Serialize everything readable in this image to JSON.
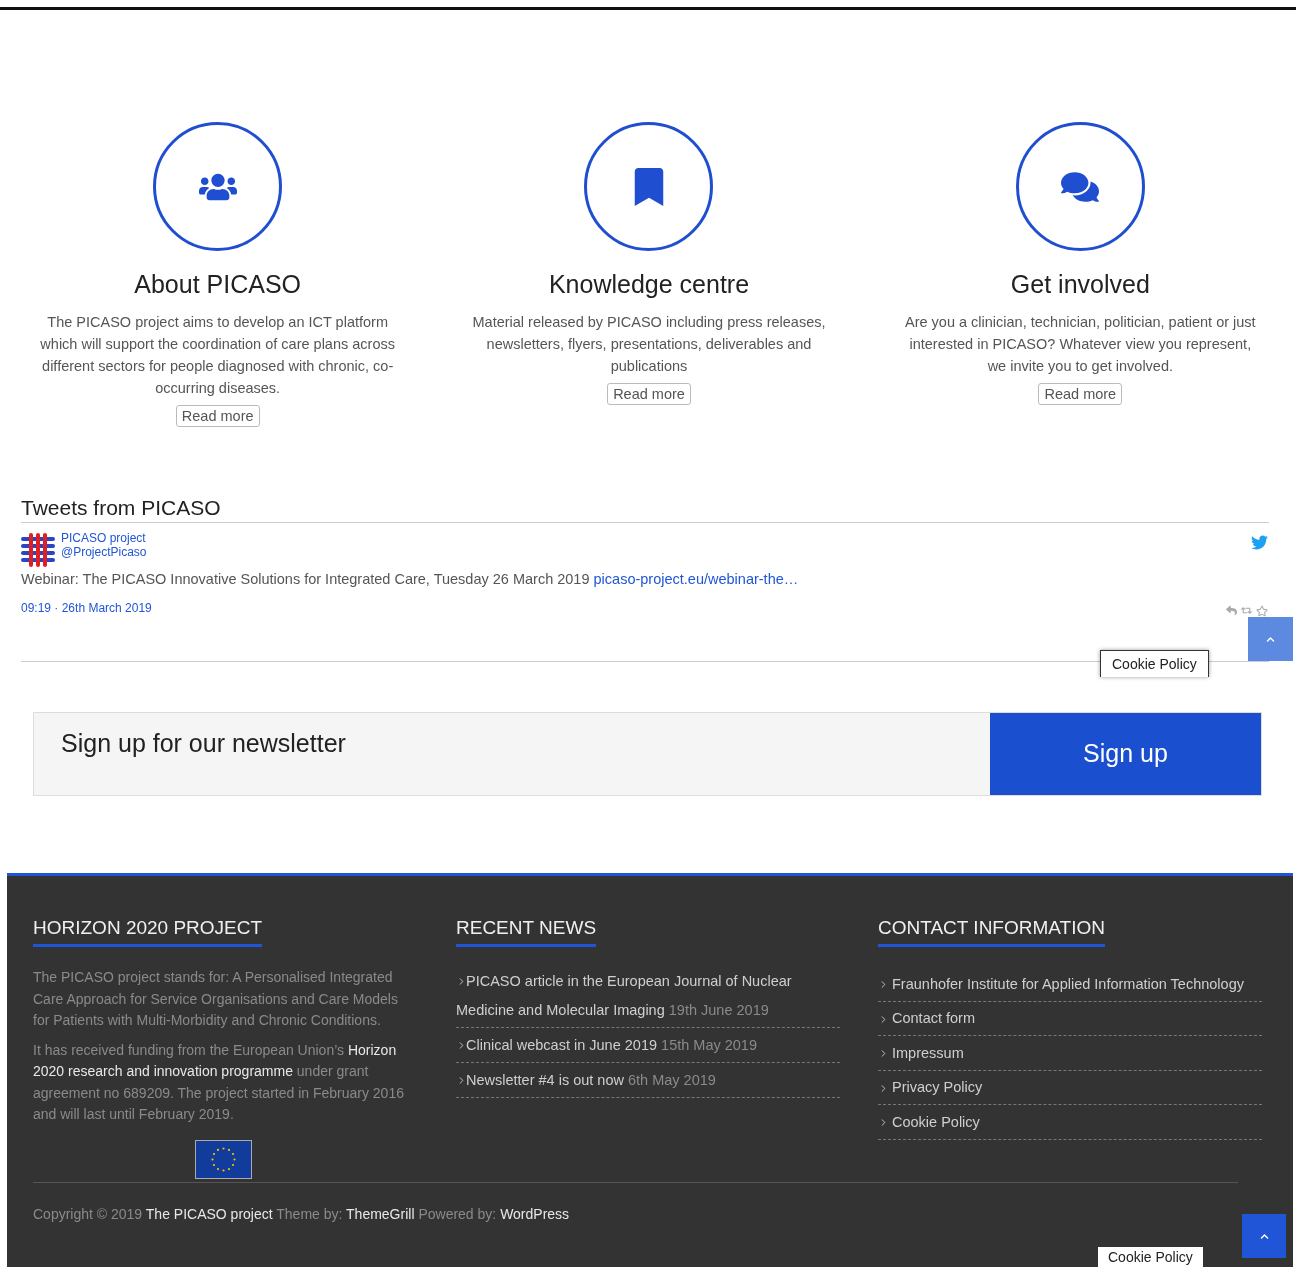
{
  "features": [
    {
      "title": "About PICASO",
      "description": "The PICASO project aims to develop an ICT platform which will support the coordination of care plans across different sectors for people diagnosed with chronic, co-occurring diseases.",
      "button": "Read more",
      "kind": "users"
    },
    {
      "title": "Knowledge centre",
      "description": "Material released by PICASO including press releases, newsletters, flyers, presentations, deliverables and publications",
      "button": "Read more",
      "kind": "bookmark"
    },
    {
      "title": "Get involved",
      "description": "Are you a clinician, technician, politician, patient or just interested in PICASO? Whatever view you represent, we invite you to get involved.",
      "button": "Read more",
      "kind": "comments"
    }
  ],
  "tweets": {
    "heading": "Tweets from PICASO",
    "author": "PICASO project",
    "handle": "@ProjectPicaso",
    "text": "Webinar: The PICASO Innovative Solutions for Integrated Care, Tuesday 26 March 2019",
    "link": "picaso-project.eu/webinar-the…",
    "time": "09:19 · 26th March 2019"
  },
  "newsletter": {
    "heading": "Sign up for our newsletter",
    "button": "Sign up"
  },
  "footer": {
    "project": {
      "heading": "HORIZON 2020 PROJECT",
      "paragraphs": [
        [
          {
            "text": "The PICASO project stands for: A Personalised Integrated Care Approach for Service Organisations and Care Models for Patients with Multi-Morbidity and Chronic Conditions.",
            "highlight": false
          }
        ],
        [
          {
            "text": "It has received funding from the European Union’s ",
            "highlight": false
          },
          {
            "text": "Horizon 2020 research and innovation programme",
            "highlight": true
          },
          {
            "text": " under grant agreement no 689209. The project started in February 2016 and will last until February 2019.",
            "highlight": false
          }
        ]
      ]
    },
    "news": {
      "heading": "RECENT NEWS",
      "items": [
        {
          "title": "PICASO article in the European Journal of Nuclear Medicine and Molecular Imaging",
          "date": "19th June 2019"
        },
        {
          "title": "Clinical webcast in June 2019",
          "date": "15th May 2019"
        },
        {
          "title": "Newsletter #4 is out now",
          "date": "6th May 2019"
        }
      ]
    },
    "contact": {
      "heading": "CONTACT INFORMATION",
      "items": [
        "Fraunhofer Institute for Applied Information Technology",
        "Contact form",
        "Impressum",
        "Privacy Policy",
        "Cookie Policy"
      ]
    },
    "copyright": [
      {
        "text": "Copyright © 2019 ",
        "highlight": false
      },
      {
        "text": "The PICASO project",
        "highlight": true
      },
      {
        "text": " Theme by: ",
        "highlight": false
      },
      {
        "text": "ThemeGrill",
        "highlight": true
      },
      {
        "text": " Powered by: ",
        "highlight": false
      },
      {
        "text": "WordPress",
        "highlight": true
      }
    ]
  },
  "cookie_tabs": [
    "Cookie Policy",
    "Cookie Policy"
  ]
}
